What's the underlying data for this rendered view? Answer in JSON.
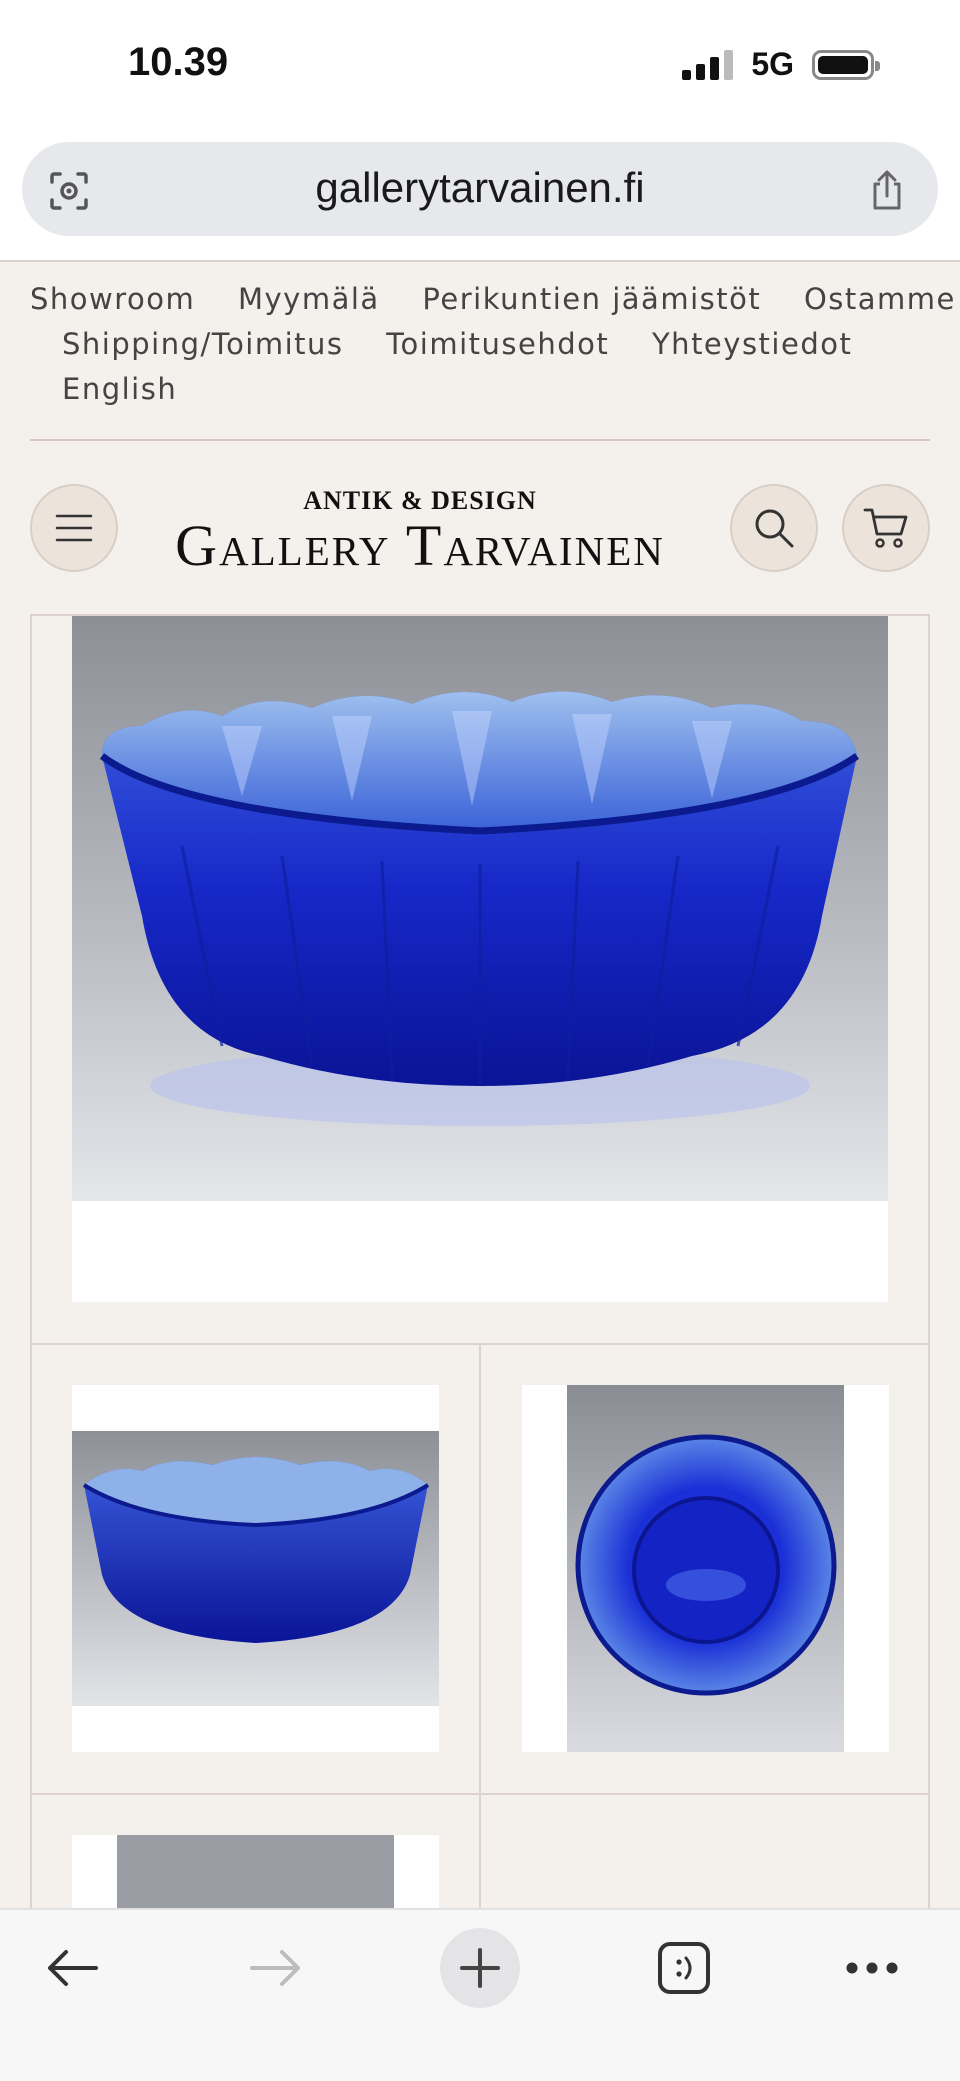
{
  "status": {
    "time": "10.39",
    "network": "5G"
  },
  "browser": {
    "url": "gallerytarvainen.fi"
  },
  "nav": {
    "items": [
      "Showroom",
      "Myymälä",
      "Perikuntien jäämistöt",
      "Ostamme",
      "Shipping/Toimitus",
      "Toimitusehdot",
      "Yhteystiedot",
      "English"
    ]
  },
  "logo": {
    "top": "ANTIK & DESIGN",
    "main": "Gallery Tarvainen"
  },
  "colors": {
    "background": "#f4f1ec",
    "glass_blue": "#1a2fd6",
    "button_bg": "#ece3da"
  },
  "icons": [
    "screen-capture-icon",
    "share-icon",
    "menu-icon",
    "search-icon",
    "cart-icon",
    "back-arrow-icon",
    "forward-arrow-icon",
    "plus-icon",
    "tabs-icon",
    "more-icon"
  ]
}
